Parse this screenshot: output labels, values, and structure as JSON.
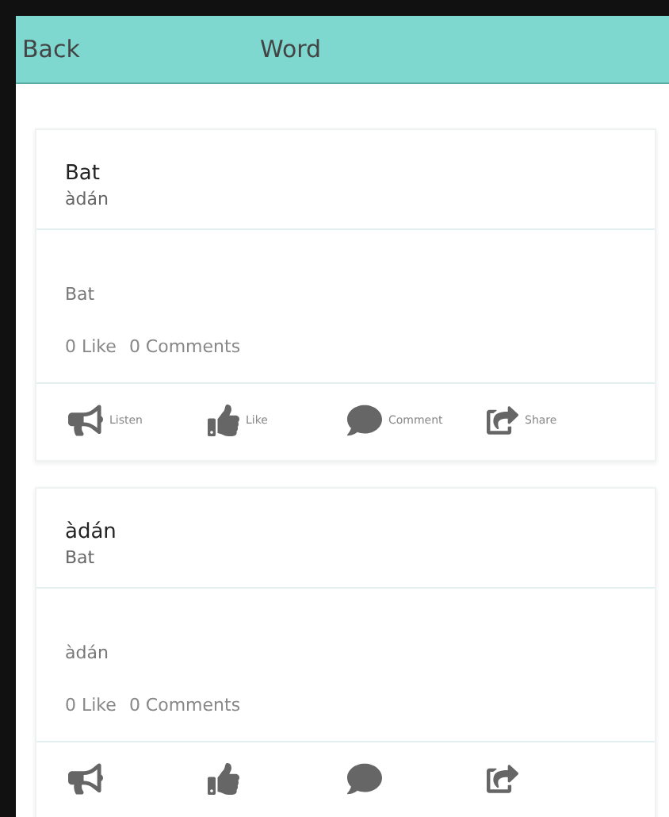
{
  "header": {
    "back": "Back",
    "title": "Word"
  },
  "cards": [
    {
      "title": "Bat",
      "subtitle": "àdán",
      "body": "Bat",
      "likes": "0 Like",
      "comments": "0 Comments",
      "actions": [
        {
          "kind": "listen",
          "label": "Listen"
        },
        {
          "kind": "like",
          "label": "Like"
        },
        {
          "kind": "comment",
          "label": "Comment"
        },
        {
          "kind": "share",
          "label": "Share"
        }
      ]
    },
    {
      "title": "àdán",
      "subtitle": "Bat",
      "body": "àdán",
      "likes": "0 Like",
      "comments": "0 Comments",
      "actions": [
        {
          "kind": "listen"
        },
        {
          "kind": "like"
        },
        {
          "kind": "comment"
        },
        {
          "kind": "share"
        }
      ]
    }
  ]
}
